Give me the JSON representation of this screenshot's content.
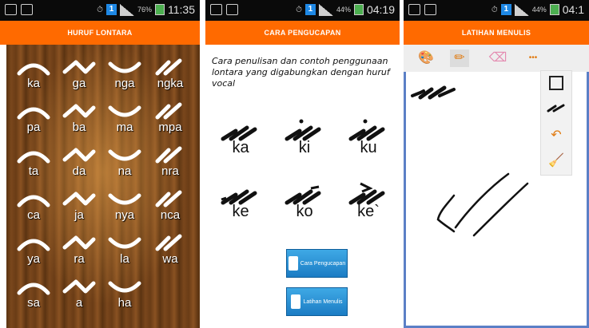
{
  "status_bars": [
    {
      "time": "11:35",
      "battery": "76%"
    },
    {
      "time": "04:19",
      "battery": "44%"
    },
    {
      "time": "04:1",
      "battery": "44%"
    }
  ],
  "panel1": {
    "title": "HURUF LONTARA",
    "letters": [
      "ka",
      "ga",
      "nga",
      "ngka",
      "pa",
      "ba",
      "ma",
      "mpa",
      "ta",
      "da",
      "na",
      "nra",
      "ca",
      "ja",
      "nya",
      "nca",
      "ya",
      "ra",
      "la",
      "wa",
      "sa",
      "a",
      "ha"
    ]
  },
  "panel2": {
    "title": "CARA PENGUCAPAN",
    "intro": "Cara penulisan dan contoh penggunaan lontara yang digabungkan dengan huruf vocal",
    "examples": [
      "ka",
      "ki",
      "ku",
      "ke",
      "ko",
      "ke`"
    ],
    "btn_pengucapan": "Cara Pengucapan",
    "btn_latihan": "Latihan Menulis"
  },
  "panel3": {
    "title": "LATIHAN MENULIS",
    "toolbar": [
      "palette-icon",
      "pencil-icon",
      "eraser-icon",
      "more-icon"
    ],
    "more_label": "•••",
    "side_tools": [
      "square-icon",
      "stroke-icon",
      "undo-icon",
      "broom-icon"
    ]
  },
  "colors": {
    "accent": "#ff6a00",
    "button": "#1b7cc4",
    "canvas_border": "#5b7fc6"
  }
}
